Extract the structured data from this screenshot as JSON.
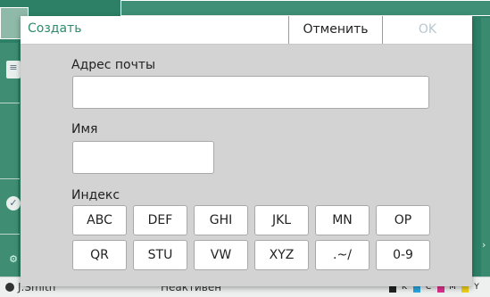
{
  "background": {
    "user_name": "J.Smith",
    "status": "Неактивен",
    "ink_labels": [
      "K",
      "C",
      "M",
      "Y"
    ],
    "ink_colors": [
      "#222222",
      "#2aa7e0",
      "#e0308f",
      "#f2d21b"
    ]
  },
  "dialog": {
    "title": "Создать",
    "cancel_label": "Отменить",
    "ok_label": "OK",
    "email_label": "Адрес почты",
    "email_value": "",
    "name_label": "Имя",
    "name_value": "",
    "index_label": "Индекс",
    "index_keys": [
      "ABC",
      "DEF",
      "GHI",
      "JKL",
      "MN",
      "OP",
      "QR",
      "STU",
      "VW",
      "XYZ",
      ".~/",
      "0-9"
    ]
  },
  "colors": {
    "accent": "#2e8d6d",
    "dialog_bg": "#d3d3d3",
    "disabled_text": "#b8c6cf"
  }
}
